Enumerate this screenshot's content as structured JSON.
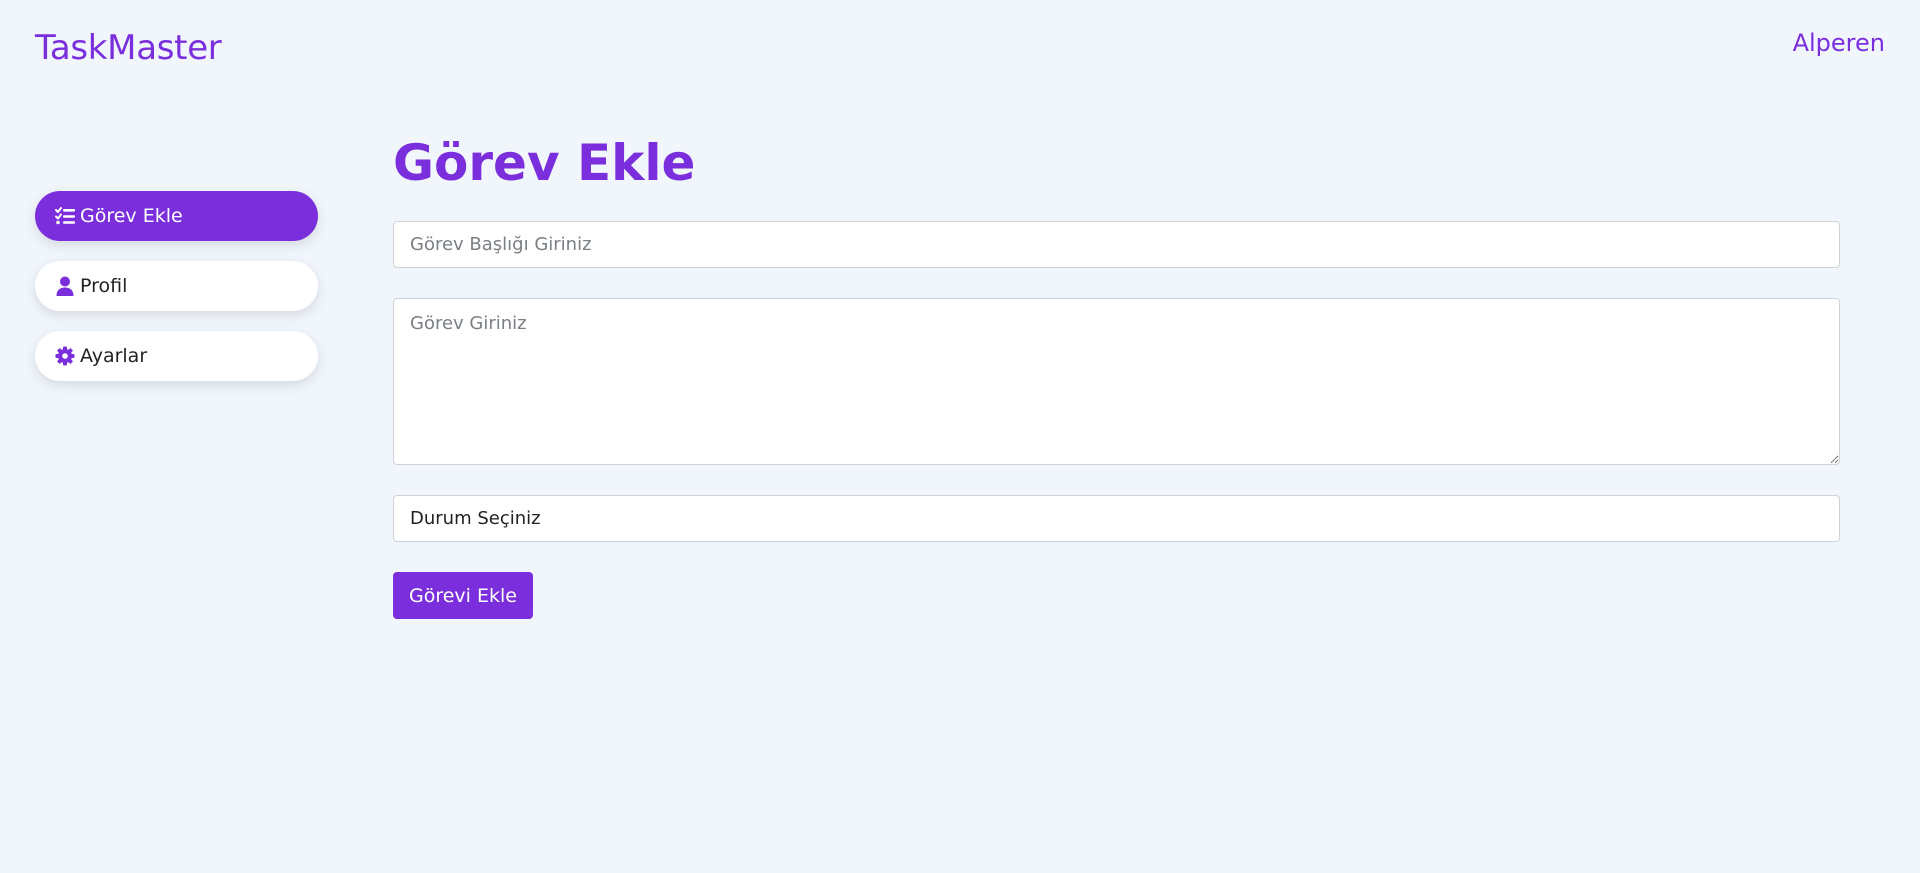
{
  "header": {
    "brand": "TaskMaster",
    "user_name": "Alperen"
  },
  "sidebar": {
    "items": [
      {
        "label": "Görev Ekle",
        "icon": "list-check-icon",
        "active": true
      },
      {
        "label": "Profil",
        "icon": "user-icon",
        "active": false
      },
      {
        "label": "Ayarlar",
        "icon": "gear-icon",
        "active": false
      }
    ]
  },
  "main": {
    "title": "Görev Ekle",
    "title_input": {
      "placeholder": "Görev Başlığı Giriniz",
      "value": ""
    },
    "task_textarea": {
      "placeholder": "Görev Giriniz",
      "value": ""
    },
    "status_select": {
      "selected": "Durum Seçiniz"
    },
    "submit_label": "Görevi Ekle"
  },
  "colors": {
    "accent": "#7a2edc",
    "background": "#f1f6fd"
  }
}
